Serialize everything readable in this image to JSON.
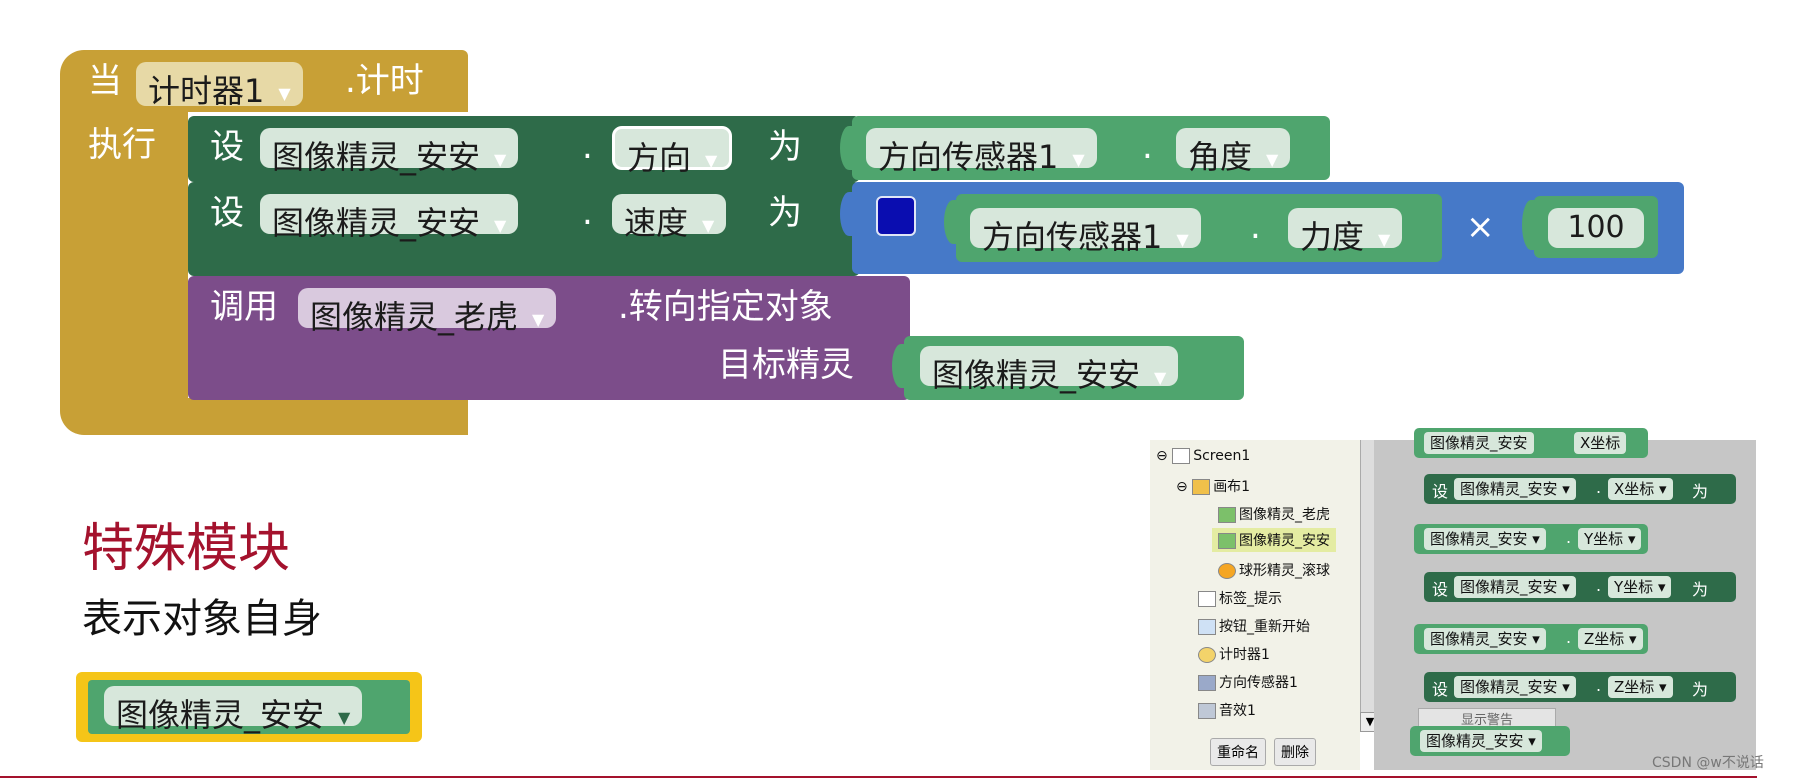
{
  "colors": {
    "event": "#C8A036",
    "setter": "#2E6B49",
    "getter": "#4FA56E",
    "call": "#7C4D8A",
    "math": "#4679C8",
    "accent": "#A4122D"
  },
  "event_block": {
    "when": "当",
    "component": "计时器1",
    "event": ".计时",
    "do": "执行"
  },
  "row1": {
    "set": "设",
    "component": "图像精灵_安安",
    "dot": ".",
    "property": "方向",
    "to": "为",
    "sensor": "方向传感器1",
    "dot2": ".",
    "sensor_prop": "角度"
  },
  "row2": {
    "set": "设",
    "component": "图像精灵_安安",
    "dot": ".",
    "property": "速度",
    "to": "为",
    "sensor": "方向传感器1",
    "dot2": ".",
    "sensor_prop": "力度",
    "times": "×",
    "number": "100"
  },
  "call_block": {
    "call": "调用",
    "component": "图像精灵_老虎",
    "method": ".转向指定对象",
    "param": "目标精灵",
    "arg": "图像精灵_安安"
  },
  "caption": {
    "title": "特殊模块",
    "subtitle": "表示对象自身",
    "self_block": "图像精灵_安安"
  },
  "tree": {
    "items": [
      "Screen1",
      "画布1",
      "图像精灵_老虎",
      "图像精灵_安安",
      "球形精灵_滚球",
      "标签_提示",
      "按钮_重新开始",
      "计时器1",
      "方向传感器1",
      "音效1"
    ],
    "rename": "重命名",
    "delete": "删除"
  },
  "workspace": {
    "component": "图像精灵_安安",
    "dot": ".",
    "set": "设",
    "to": "为",
    "xprop": "X坐标",
    "yprop": "Y坐标",
    "zprop": "Z坐标",
    "hint": "显示警告"
  },
  "watermark": "CSDN @w不说话"
}
